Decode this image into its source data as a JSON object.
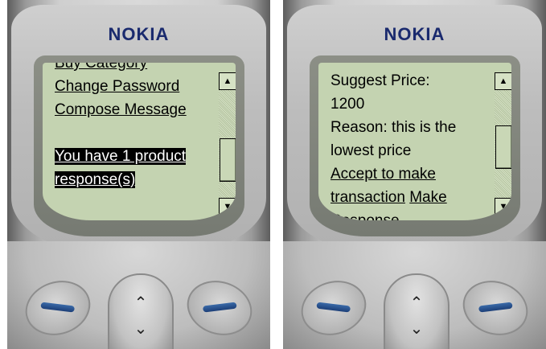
{
  "left_phone": {
    "brand": "NOKIA",
    "lines": [
      {
        "text": "Buy Category",
        "link": true,
        "highlight": false
      },
      {
        "text": "Change Password",
        "link": true,
        "highlight": false
      },
      {
        "text": "Compose Message",
        "link": true,
        "highlight": false
      },
      {
        "text": "",
        "link": false,
        "highlight": false
      },
      {
        "text": "You have 1 product",
        "link": true,
        "highlight": true
      },
      {
        "text": "response(s)",
        "link": true,
        "highlight": true
      }
    ],
    "scroll_position": 0.75
  },
  "right_phone": {
    "brand": "NOKIA",
    "lines": [
      {
        "text": "Suggest Price:",
        "link": false
      },
      {
        "text": "1200",
        "link": false
      },
      {
        "text": "Reason: this is the",
        "link": false
      },
      {
        "text": "lowest price",
        "link": false
      },
      {
        "text": "Accept to make",
        "link": true
      },
      {
        "text": "transaction",
        "link": true,
        "extra": "Make"
      },
      {
        "text": "Response",
        "link": true
      }
    ],
    "scroll_position": 0.55
  },
  "icons": {
    "scroll_up": "up-arrow-icon",
    "scroll_down": "down-arrow-icon",
    "soft_key": "soft-key-icon",
    "nav": "chevron-up-down-icon"
  }
}
